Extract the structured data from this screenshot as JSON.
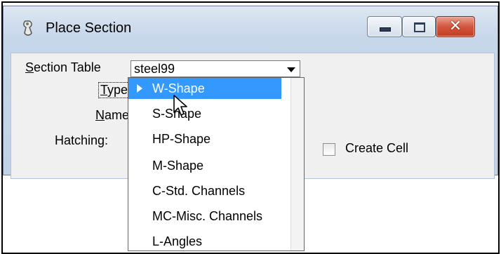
{
  "window": {
    "title": "Place Section",
    "icons": {
      "app": "section-tool-icon",
      "minimize": "minimize-icon",
      "maximize": "maximize-icon",
      "close": "close-icon"
    }
  },
  "form": {
    "section_table_label": "Section Table",
    "section_table_value": "steel99",
    "type_label": "Type:",
    "name_label": "Name:",
    "hatching_label": "Hatching:",
    "create_cell_label": "Create Cell",
    "create_cell_checked": false
  },
  "dropdown": {
    "selected_index": 0,
    "items": [
      "W-Shape",
      "S-Shape",
      "HP-Shape",
      "M-Shape",
      "C-Std. Channels",
      "MC-Misc. Channels",
      "L-Angles"
    ]
  },
  "colors": {
    "selection": "#3399ff",
    "close_button": "#c43d20"
  }
}
